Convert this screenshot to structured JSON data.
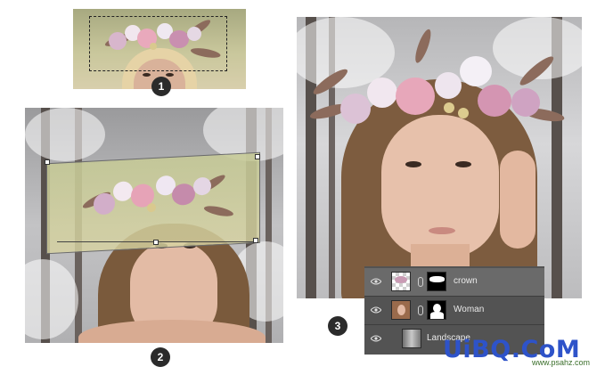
{
  "steps": [
    {
      "number": "1"
    },
    {
      "number": "2"
    },
    {
      "number": "3"
    }
  ],
  "layers_panel": {
    "layers": [
      {
        "name": "crown",
        "selected": true,
        "has_mask": true
      },
      {
        "name": "Woman",
        "selected": false,
        "has_mask": true
      },
      {
        "name": "Landscape",
        "selected": false,
        "has_mask": false
      }
    ]
  },
  "watermark": {
    "main": "UiBQ.CoM",
    "sub": "www.psahz.com"
  },
  "colors": {
    "badge": "#2b2b2b",
    "layers_bg": "#535353",
    "layer_selected": "#6a6a6a",
    "watermark_blue": "#2e53c9"
  },
  "icons": [
    "eye-icon",
    "chain-link-icon",
    "layer-thumbnail",
    "layer-mask-thumbnail"
  ]
}
